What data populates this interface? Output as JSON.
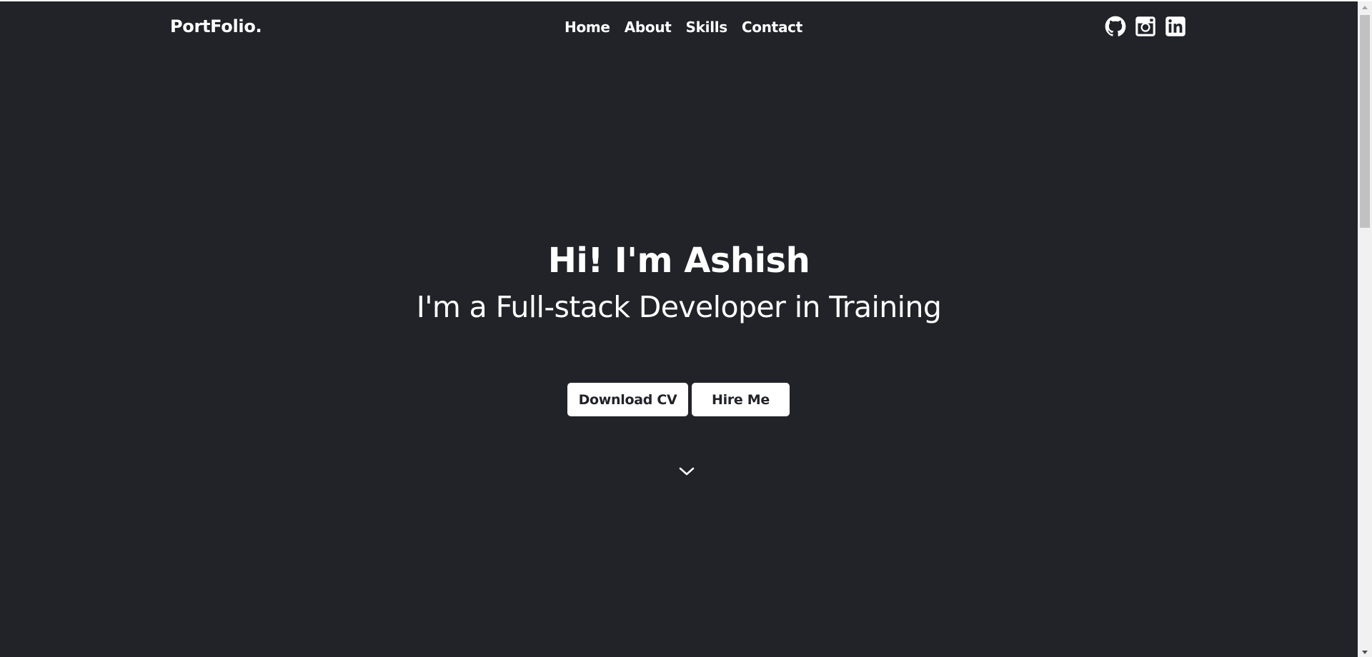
{
  "nav": {
    "brand": "PortFolio.",
    "links": [
      {
        "label": "Home"
      },
      {
        "label": "About"
      },
      {
        "label": "Skills"
      },
      {
        "label": "Contact"
      }
    ],
    "socials": [
      {
        "icon": "github-icon"
      },
      {
        "icon": "instagram-icon"
      },
      {
        "icon": "linkedin-icon"
      }
    ]
  },
  "hero": {
    "title": "Hi! I'm Ashish",
    "subtitle": "I'm a Full-stack Developer in Training",
    "buttons": {
      "download_cv": "Download CV",
      "hire_me": "Hire Me"
    },
    "scroll_icon": "chevron-down-icon"
  },
  "theme": {
    "background": "#212328",
    "text": "#ffffff",
    "button_bg": "#ffffff",
    "button_text": "#212328"
  }
}
